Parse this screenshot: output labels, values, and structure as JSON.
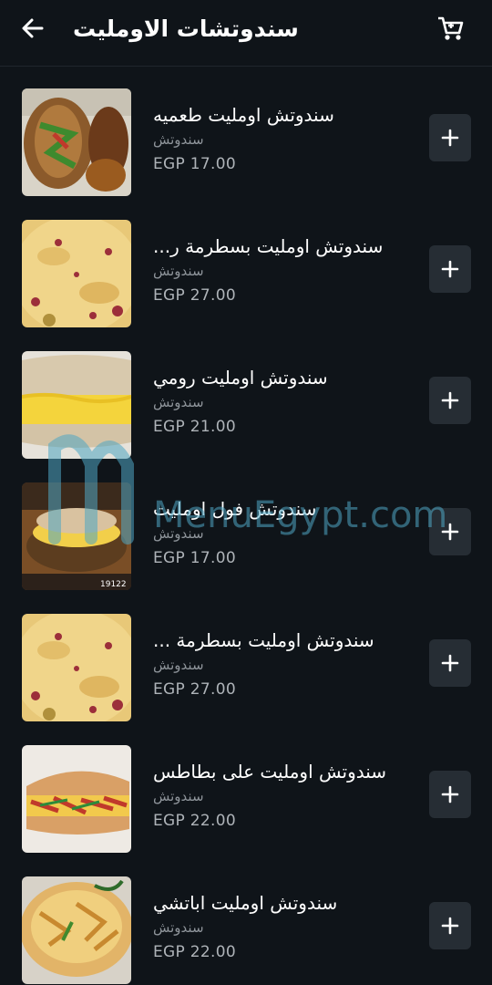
{
  "header": {
    "title": "سندوتشات الاومليت"
  },
  "items": [
    {
      "name": "سندوتش اومليت طعميه",
      "category": "سندوتش",
      "price": "EGP 17.00",
      "add_label": "+"
    },
    {
      "name": "سندوتش اومليت بسطرمة ر...",
      "category": "سندوتش",
      "price": "EGP 27.00",
      "add_label": "+"
    },
    {
      "name": "سندوتش اومليت رومي",
      "category": "سندوتش",
      "price": "EGP 21.00",
      "add_label": "+"
    },
    {
      "name": "سندوتش فول اومليت",
      "category": "سندوتش",
      "price": "EGP 17.00",
      "add_label": "+"
    },
    {
      "name": "سندوتش اومليت بسطرمة ...",
      "category": "سندوتش",
      "price": "EGP 27.00",
      "add_label": "+"
    },
    {
      "name": "سندوتش اومليت على بطاطس",
      "category": "سندوتش",
      "price": "EGP 22.00",
      "add_label": "+"
    },
    {
      "name": "سندوتش اومليت اباتشي",
      "category": "سندوتش",
      "price": "EGP 22.00",
      "add_label": "+"
    }
  ],
  "thumb_badge": "19122",
  "watermark": "MenuEgypt.com",
  "colors": {
    "background": "#0f1419",
    "button_bg": "#262d34",
    "secondary_text": "#8e949a"
  }
}
